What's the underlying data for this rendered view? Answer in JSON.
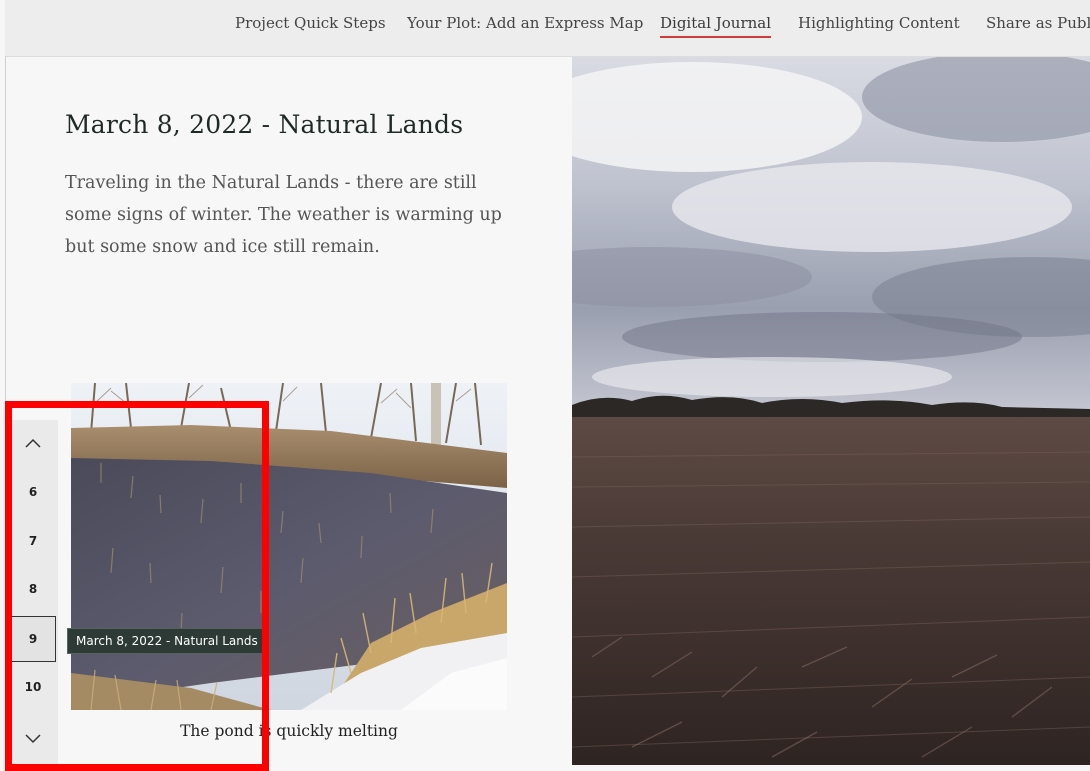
{
  "nav": {
    "items": [
      {
        "label": "Project Quick Steps",
        "active": false
      },
      {
        "label": "Your Plot: Add an Express Map",
        "active": false
      },
      {
        "label": "Digital Journal",
        "active": true
      },
      {
        "label": "Highlighting Content",
        "active": false
      },
      {
        "label": "Share as Public",
        "active": false
      }
    ]
  },
  "entry": {
    "title": "March 8, 2022 - Natural Lands",
    "body": "Traveling in the Natural Lands - there are still some signs of winter. The weather is warming up but some snow and ice still remain.",
    "photo_caption": "The pond is quickly melting"
  },
  "rail": {
    "up_icon": "chevron-up-icon",
    "down_icon": "chevron-down-icon",
    "pages": [
      "6",
      "7",
      "8",
      "9",
      "10"
    ],
    "current": "9",
    "tooltip": "March 8, 2022 - Natural Lands"
  },
  "colors": {
    "accent_underline": "#d33a3a",
    "highlight": "#ff0000",
    "tooltip_bg": "#2d3a36"
  }
}
